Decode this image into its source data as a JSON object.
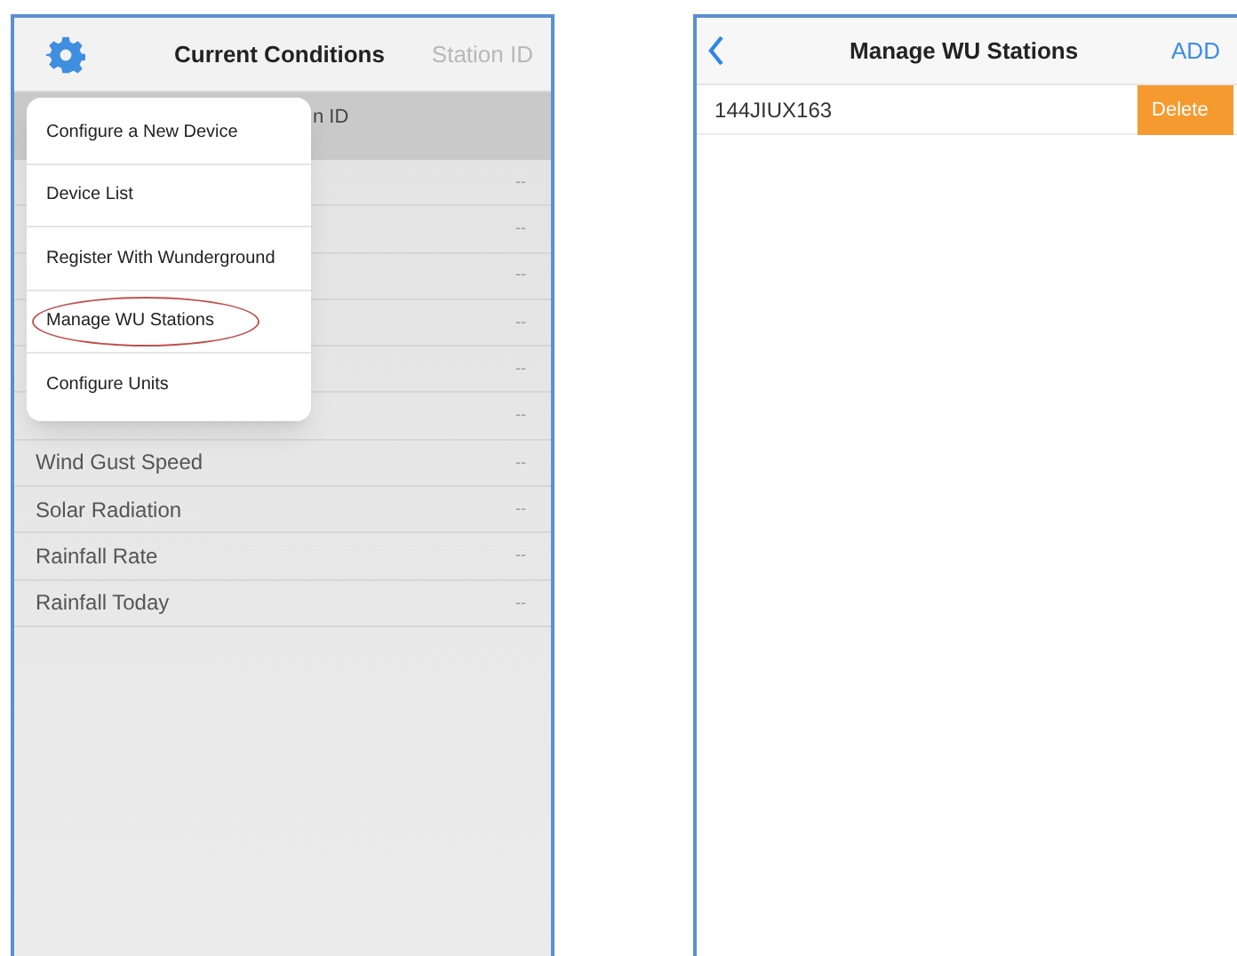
{
  "left_screen": {
    "title": "Current Conditions",
    "header_action": "Station ID",
    "column_header": "n ID",
    "rows": [
      {
        "value": "--"
      },
      {
        "value": "--"
      },
      {
        "value": "--"
      },
      {
        "value": "--"
      },
      {
        "value": "--"
      },
      {
        "value": "--"
      },
      {
        "label": "Wind Gust Speed",
        "value": "--"
      },
      {
        "label": "Solar Radiation",
        "value": "--"
      },
      {
        "label": "Rainfall Rate",
        "value": "--"
      },
      {
        "label": "Rainfall Today",
        "value": "--"
      }
    ],
    "menu": {
      "items": [
        {
          "label": "Configure a New Device",
          "circled": false
        },
        {
          "label": "Device List",
          "circled": false
        },
        {
          "label": "Register With Wunderground",
          "circled": false
        },
        {
          "label": "Manage WU Stations",
          "circled": true
        },
        {
          "label": "Configure Units",
          "circled": false
        }
      ]
    }
  },
  "right_screen": {
    "title": "Manage WU Stations",
    "action": "ADD",
    "stations": [
      {
        "id": "144JIUX163",
        "delete": "Delete"
      }
    ]
  }
}
